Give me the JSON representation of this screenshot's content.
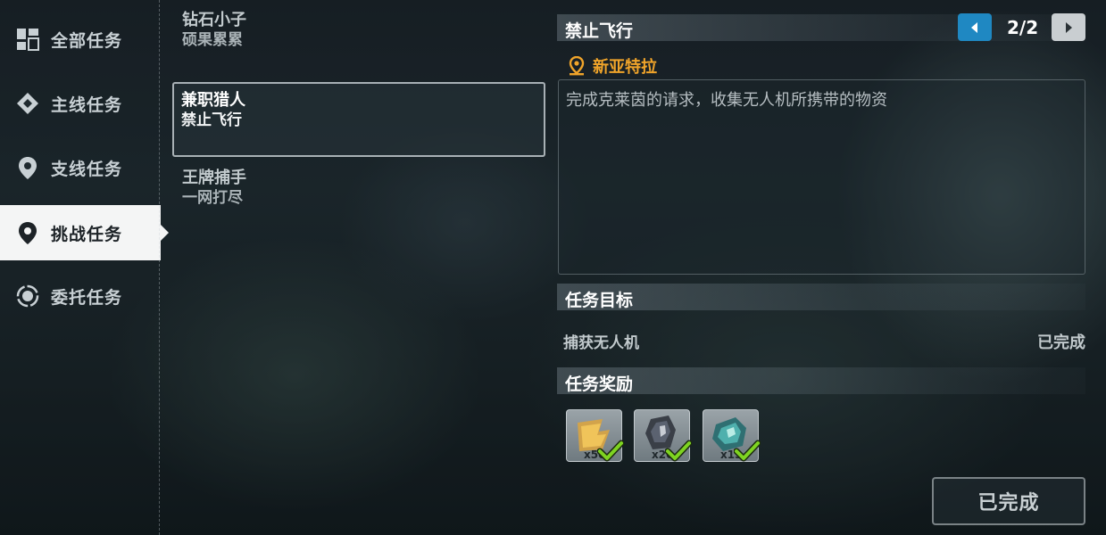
{
  "sidebar": {
    "items": [
      {
        "label": "全部任务",
        "icon": "grid-icon",
        "active": false
      },
      {
        "label": "主线任务",
        "icon": "diamond-marker-icon",
        "active": false
      },
      {
        "label": "支线任务",
        "icon": "map-pin-icon",
        "active": false
      },
      {
        "label": "挑战任务",
        "icon": "map-pin-icon",
        "active": true
      },
      {
        "label": "委托任务",
        "icon": "target-ring-icon",
        "active": false
      }
    ]
  },
  "quests": [
    {
      "title": "钻石小子",
      "subtitle": "硕果累累"
    },
    {
      "title": "兼职猎人",
      "subtitle": "禁止飞行",
      "selected": true
    },
    {
      "title": "王牌捕手",
      "subtitle": "一网打尽"
    }
  ],
  "detail": {
    "title": "禁止飞行",
    "pager": "2/2",
    "location": "新亚特拉",
    "location_color": "#f0a42a",
    "description": "完成克莱茵的请求，收集无人机所携带的物资",
    "objective_header": "任务目标",
    "objectives": [
      {
        "name": "捕获无人机",
        "status": "已完成"
      }
    ],
    "reward_header": "任务奖励",
    "rewards": [
      {
        "icon": "exp-icon",
        "count": "x50"
      },
      {
        "icon": "dark-crystal-icon",
        "count": "x20"
      },
      {
        "icon": "teal-shard-icon",
        "count": "x13"
      }
    ],
    "complete_button": "已完成"
  },
  "colors": {
    "accent": "#1f88c2",
    "active_nav_bg": "#f4f5f5",
    "check": "#7ed321"
  }
}
